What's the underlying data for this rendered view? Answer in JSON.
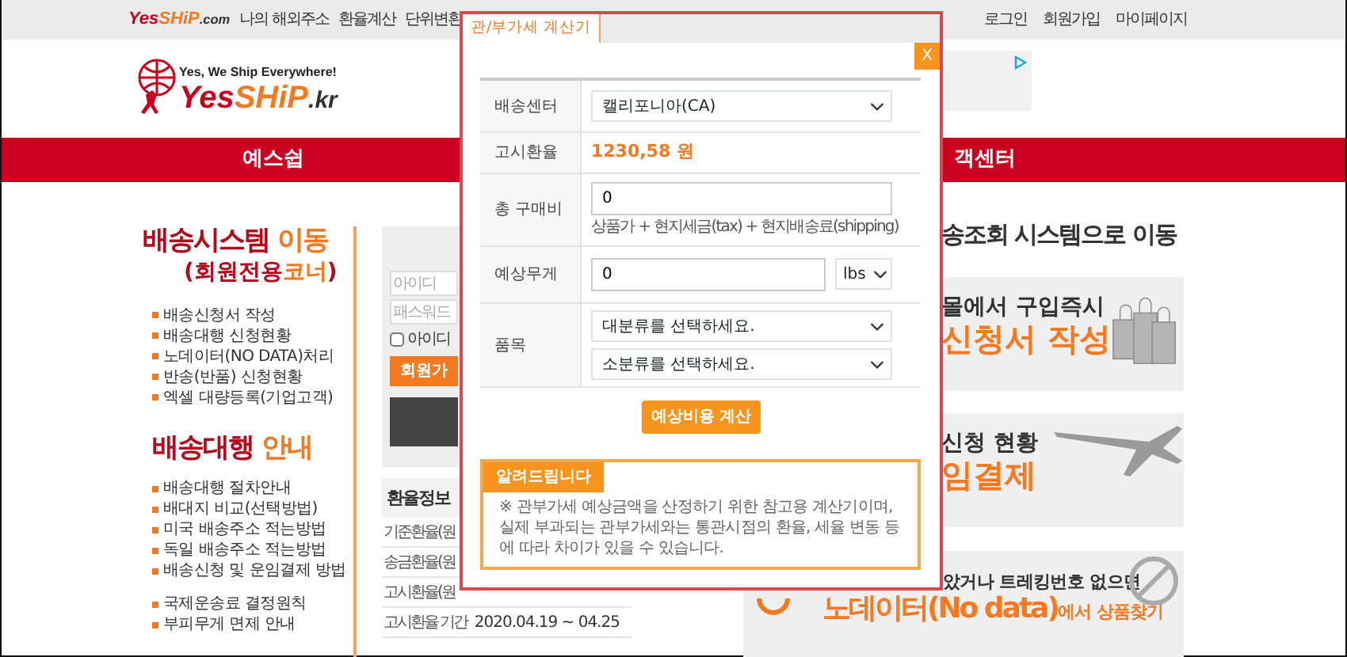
{
  "top_bar": {
    "logo": [
      "Yes",
      "SHiP",
      ".com"
    ],
    "links": [
      "나의 해외주소",
      "환율계산",
      "단위변환"
    ],
    "user_links": [
      "로그인",
      "회원가입",
      "마이페이지"
    ]
  },
  "header": {
    "logo": {
      "tagline": "Yes, We Ship Everywhere!",
      "name": [
        "Yes",
        "SHiP",
        ".kr"
      ]
    }
  },
  "red_bar": {
    "items": [
      "예스쉽",
      "객센터"
    ]
  },
  "shipping_system": {
    "title": {
      "main": "배송시스템",
      "accent": "이동"
    },
    "subtitle": {
      "before": "(회원전용",
      "accent": "코너",
      "after": ")"
    },
    "items": [
      "배송신청서 작성",
      "배송대행 신청현황",
      "노데이터(NO DATA)처리",
      "반송(반품) 신청현황",
      "엑셀 대량등록(기업고객)"
    ]
  },
  "guide": {
    "title": {
      "main": "배송대행",
      "accent": "안내"
    },
    "groups": [
      [
        "배송대행 절차안내",
        "배대지 비교(선택방법)",
        "미국 배송주소 적는방법",
        "독일 배송주소 적는방법",
        "배송신청 및 운임결제 방법"
      ],
      [
        "국제운송료 결정원칙",
        "부피무게 면제 안내"
      ]
    ]
  },
  "login": {
    "id_placeholder": "아이디",
    "password_placeholder": "패스워드",
    "remember": {
      "label": "아이디",
      "checked": false
    },
    "button": "회원가"
  },
  "exchange": {
    "title": "환율정보",
    "rows": [
      {
        "label": "기준환율(원"
      },
      {
        "label": "송금환율(원"
      },
      {
        "label": "고시환율(원"
      },
      {
        "label": "고시환율 기간",
        "value": "2020.04.19 ~ 04.25"
      }
    ]
  },
  "right": {
    "heading": "송조회 시스템으로 이동",
    "banners": [
      {
        "kind": "bags",
        "line_1": "몰에서 구입즉시",
        "line_2": "신청서 작성"
      },
      {
        "kind": "plane",
        "line_1": "신청 현황",
        "line_2": "임결제"
      },
      {
        "kind": "nodata",
        "line_1": "았거나 트레킹번호 없으면",
        "line_2": "노데이터(No data)",
        "line_2_suffix": "에서 상품찾기"
      }
    ]
  },
  "modal": {
    "tab": {
      "label": "관/부가세 계산기",
      "selected": true
    },
    "close": "X",
    "form": [
      {
        "kind": "select",
        "label": "배송센터",
        "value": "캘리포니아(CA)"
      },
      {
        "kind": "text",
        "label": "고시환율",
        "value": "1230,58 원"
      },
      {
        "kind": "input",
        "label": "총 구매비",
        "value": "0",
        "hint": "상품가 + 현지세금(tax) + 현지배송료(shipping)"
      },
      {
        "kind": "input_unit",
        "label": "예상무게",
        "value": "0",
        "unit": "lbs"
      },
      {
        "kind": "selects",
        "label": "품목",
        "options": [
          "대분류를 선택하세요.",
          "소분류를 선택하세요."
        ]
      }
    ],
    "button": "예상비용 계산",
    "notice": {
      "title": "알려드립니다",
      "text": "※ 관부가세 예상금액을 산정하기 위한 참고용 계산기이며, 실제 부과되는 관부가세와는 통관시점의 환율, 세율 변동 등에 따라 차이가 있을 수 있습니다."
    }
  }
}
